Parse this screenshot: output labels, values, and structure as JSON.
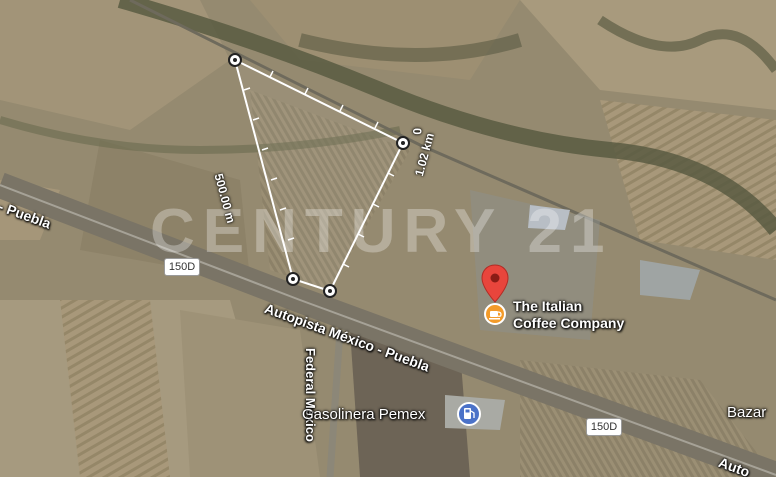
{
  "map": {
    "watermark": "CENTURY 21",
    "road_labels": {
      "road_left": "- Puebla",
      "highway_main": "Autopista México - Puebla",
      "federal_road": "Federal México",
      "bottom_right_road": "Auto"
    },
    "highway_shields": [
      "150D",
      "150D"
    ],
    "places": {
      "coffee_name": "The Italian Coffee Company",
      "coffee_line1": "The Italian",
      "coffee_line2": "Coffee Company",
      "gas_station": "Gasolinera Pemex",
      "bazar": "Bazar"
    },
    "measurement": {
      "side_label": "500.00 m",
      "total_label": "1.02 km",
      "zero_label": "0"
    },
    "colors": {
      "pin": "#e8453c",
      "coffee_icon": "#f39b2a",
      "gas_icon": "#4b72c8",
      "measure_line": "#ffffff"
    }
  }
}
